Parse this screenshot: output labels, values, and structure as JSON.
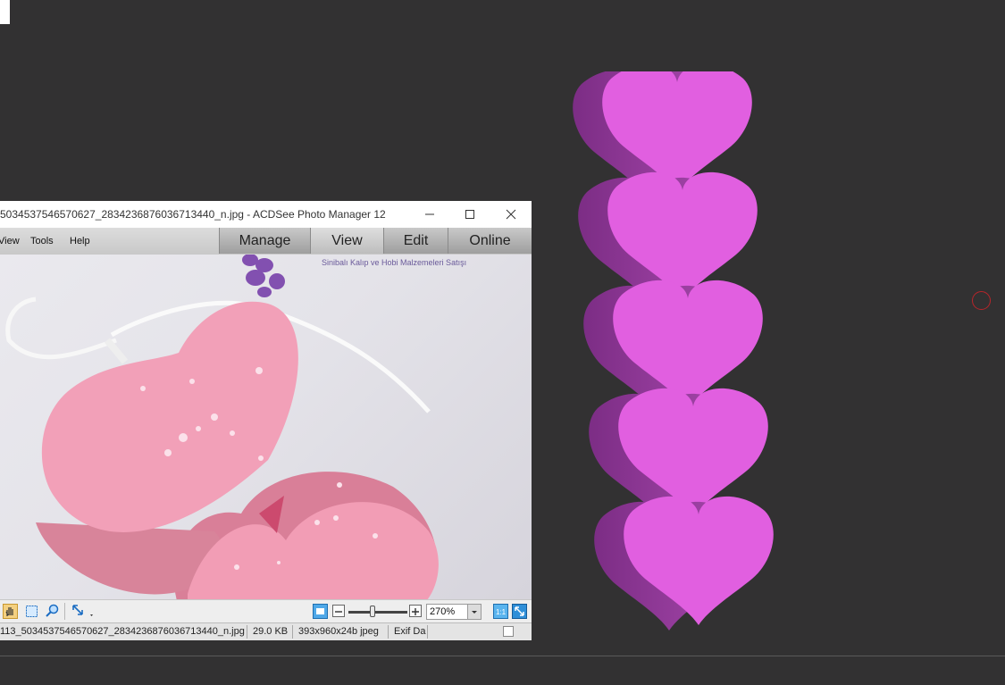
{
  "window": {
    "title": "5034537546570627_2834236876036713440_n.jpg - ACDSee Photo Manager 12",
    "controls": [
      "minimize-icon",
      "maximize-icon",
      "close-icon"
    ]
  },
  "menu": {
    "items": [
      "View",
      "Tools",
      "Help"
    ]
  },
  "modes": {
    "tabs": [
      "Manage",
      "View",
      "Edit",
      "Online"
    ],
    "active": "View"
  },
  "photo": {
    "caption": "Sinibalı Kalıp ve Hobi Malzemeleri Satışı"
  },
  "toolbar": {
    "icons": [
      "hand-tool-icon",
      "select-tool-icon",
      "zoom-tool-icon",
      "resize-icon",
      "fit-image-icon",
      "zoom-out-icon",
      "zoom-in-icon",
      "actual-size-icon",
      "full-screen-icon"
    ],
    "zoom_value": "270%",
    "zoom_slider_level": 0.45
  },
  "statusbar": {
    "filename": "113_5034537546570627_2834236876036713440_n.jpg",
    "size": "29.0 KB",
    "dimensions": "393x960x24b jpeg",
    "exif": "Exif Da"
  },
  "canvas": {
    "background": "#323132",
    "heart_face_color": "#e15fe0",
    "heart_side_color": "#9b3fa3",
    "heart_count": 5
  }
}
